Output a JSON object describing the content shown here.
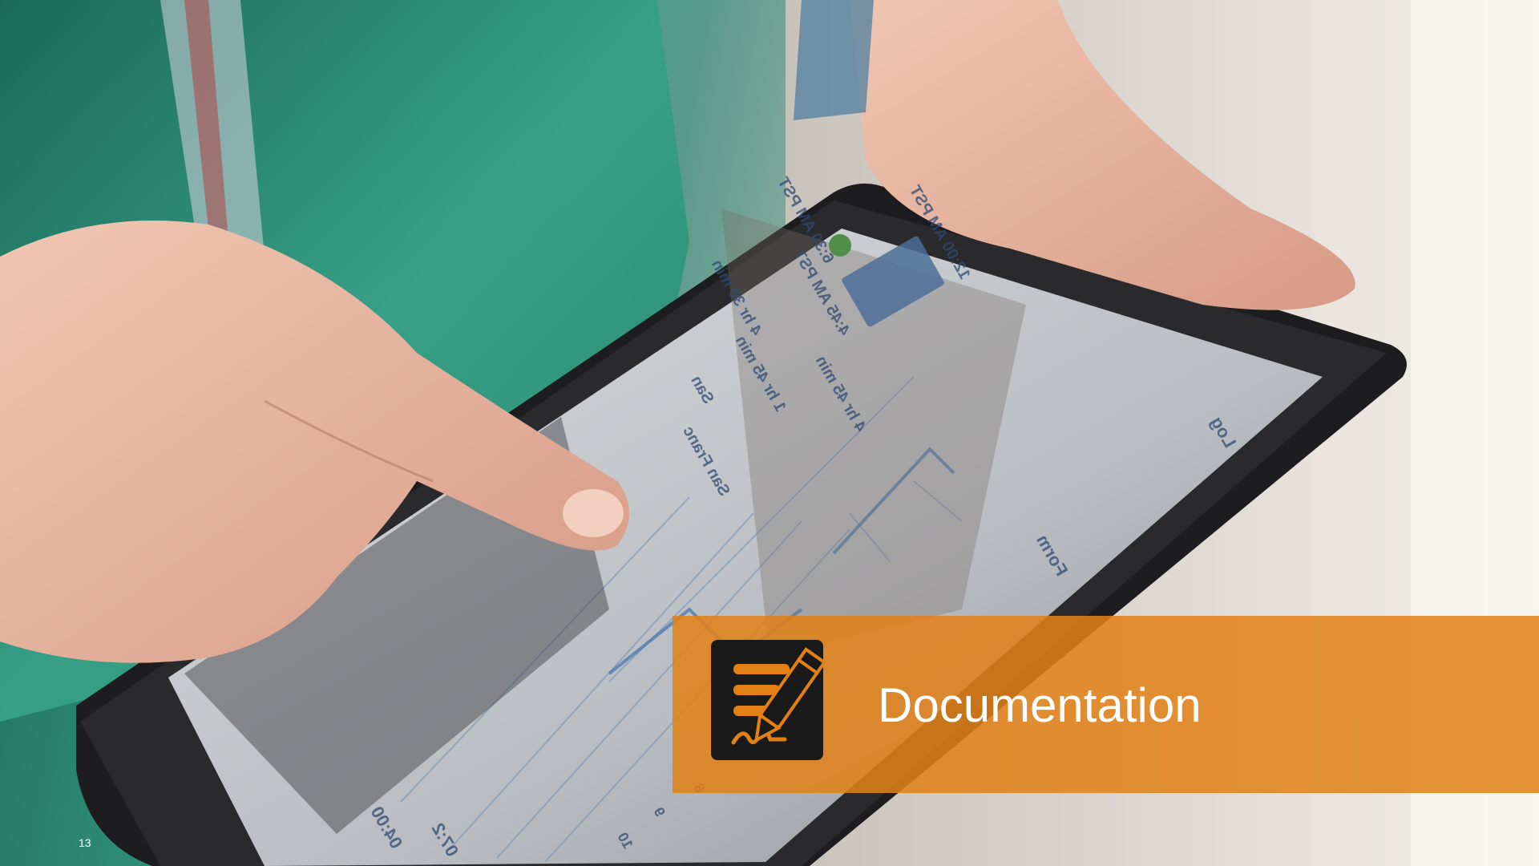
{
  "slide": {
    "title": "Documentation",
    "page_number": "13",
    "accent_color": "#e28016",
    "icon": "document-signature-icon"
  },
  "tablet_screen": {
    "visible_text": [
      "6:30 AM PST",
      "4 hr 30 min",
      "San",
      "4:45 AM PST",
      "1 hr 45 min",
      "San Franc",
      "12:00 AM PST",
      "4 hr 45 min",
      "Form",
      "Log",
      "04:00",
      "07:2",
      "10",
      "9",
      "8"
    ]
  }
}
